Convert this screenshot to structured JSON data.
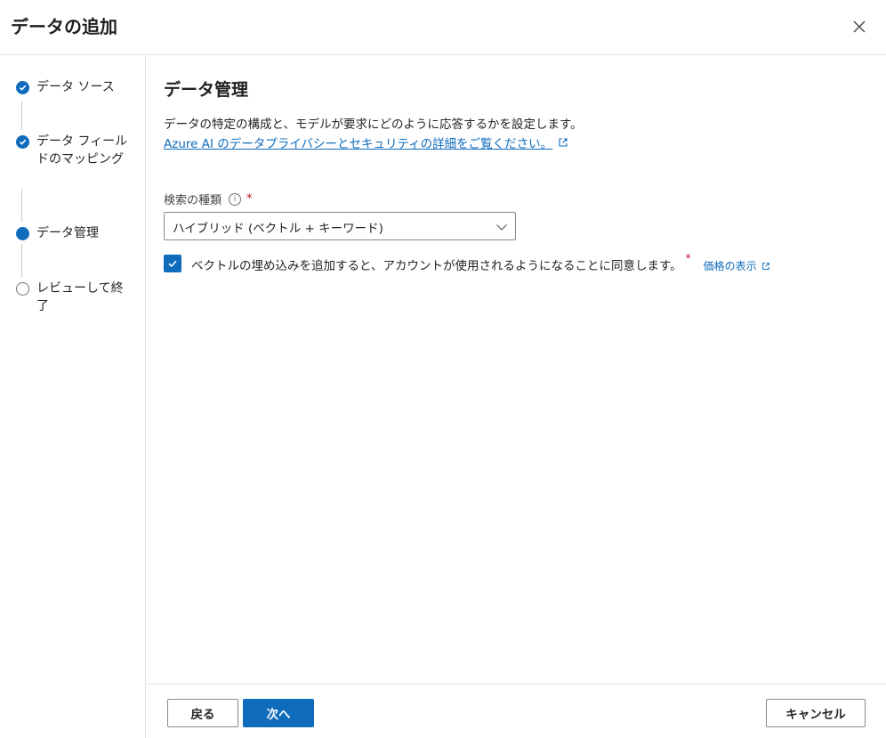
{
  "dialog": {
    "title": "データの追加",
    "close_icon": "close-icon"
  },
  "steps": [
    {
      "label": "データ ソース",
      "state": "completed"
    },
    {
      "label": "データ フィールドのマッピング",
      "state": "completed"
    },
    {
      "label": "データ管理",
      "state": "current"
    },
    {
      "label": "レビューして終了",
      "state": "pending"
    }
  ],
  "content": {
    "title": "データ管理",
    "description": "データの特定の構成と、モデルが要求にどのように応答するかを設定します。",
    "privacy_link": "Azure AI のデータプライバシーとセキュリティの詳細をご覧ください。",
    "search_type": {
      "label": "検索の種類",
      "required_mark": "*",
      "selected": "ハイブリッド (ベクトル + キーワード)"
    },
    "consent": {
      "checked": true,
      "text": "ベクトルの埋め込みを追加すると、アカウントが使用されるようになることに同意します。",
      "required_mark": "*",
      "pricing_link": "価格の表示"
    }
  },
  "footer": {
    "back_label": "戻る",
    "next_label": "次へ",
    "cancel_label": "キャンセル"
  },
  "colors": {
    "accent": "#0f6cbd",
    "required": "#c50f1f",
    "border": "#e5e5e5"
  }
}
